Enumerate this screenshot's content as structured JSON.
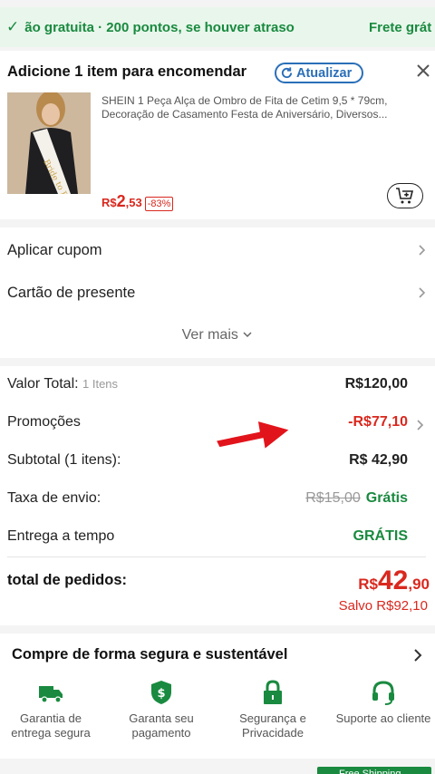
{
  "banner": {
    "text": "ão gratuita · 200 pontos, se houver atraso",
    "text_right": "Frete grát"
  },
  "addon": {
    "title": "Adicione 1 item para encomendar",
    "refresh_label": "Atualizar",
    "product": {
      "description": "SHEIN 1 Peça Alça de Ombro de Fita de Cetim 9,5 * 79cm, Decoração de Casamento Festa de Aniversário, Diversos...",
      "price_currency": "R$",
      "price_int": "2",
      "price_dec": ",53",
      "discount": "-83%",
      "sash_text": "Bride to Be"
    }
  },
  "links": {
    "coupon": "Aplicar cupom",
    "gift_card": "Cartão de presente",
    "see_more": "Ver mais"
  },
  "totals": {
    "total_label": "Valor Total:",
    "total_items": "1 Itens",
    "total_value": "R$120,00",
    "promo_label": "Promoções",
    "promo_value": "-R$77,10",
    "subtotal_label": "Subtotal (1 itens):",
    "subtotal_value": "R$ 42,90",
    "shipping_label": "Taxa de envio:",
    "shipping_old": "R$15,00",
    "shipping_value": "Grátis",
    "ontime_label": "Entrega a tempo",
    "ontime_value": "GRÁTIS",
    "order_total_label": "total de pedidos:",
    "order_total_currency": "R$",
    "order_total_int": "42",
    "order_total_dec": ",90",
    "saved": "Salvo R$92,10"
  },
  "secure": {
    "title": "Compre de forma segura e sustentável",
    "features": [
      {
        "label": "Garantia de entrega segura",
        "icon": "truck-icon"
      },
      {
        "label": "Garanta seu pagamento",
        "icon": "shield-dollar-icon"
      },
      {
        "label": "Segurança e Privacidade",
        "icon": "lock-icon"
      },
      {
        "label": "Suporte ao cliente",
        "icon": "headset-icon"
      }
    ]
  },
  "bottom_badge": "Free Shipping",
  "colors": {
    "accent_green": "#198a3f",
    "price_red": "#d9281e",
    "link_blue": "#2a6fb8"
  }
}
